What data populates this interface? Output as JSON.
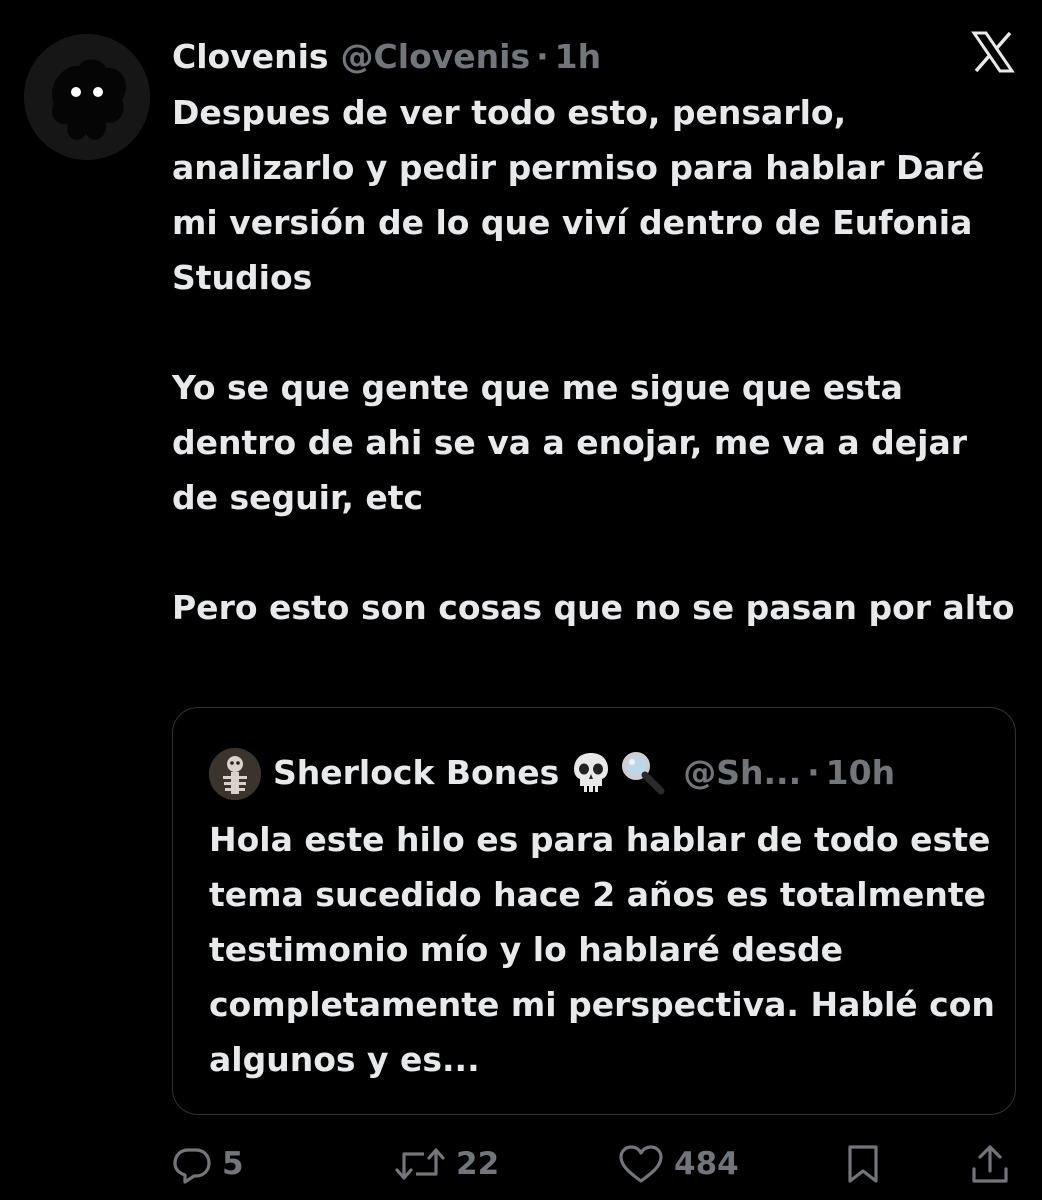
{
  "tweet": {
    "author_name": "Clovenis",
    "author_handle": "@Clovenis",
    "separator": "·",
    "time": "1h",
    "paragraphs": [
      "Despues de ver todo esto, pensarlo, analizarlo y pedir permiso para hablar Daré mi versión de lo que viví dentro de Eufonia Studios",
      "Yo se que gente que me sigue que esta dentro de ahi se va a enojar, me va a dejar de seguir, etc",
      "Pero esto son cosas que no se pasan por alto"
    ]
  },
  "quoted_tweet": {
    "author_name": "Sherlock Bones",
    "author_emojis": "💀🔍",
    "author_handle": "@Sh...",
    "separator": "·",
    "time": "10h",
    "text": "Hola este hilo es para hablar de todo este tema sucedido hace 2 años es totalmente testimonio mío y lo hablaré desde completamente mi perspectiva. Hablé con algunos y es..."
  },
  "actions": {
    "replies": "5",
    "reposts": "22",
    "likes": "484"
  },
  "icons": [
    "x-logo-icon",
    "reply-icon",
    "repost-icon",
    "like-icon",
    "bookmark-icon",
    "share-icon"
  ],
  "colors": {
    "background": "#000000",
    "text": "#e7e9ea",
    "secondary": "#71767b",
    "border": "#2f3336"
  }
}
